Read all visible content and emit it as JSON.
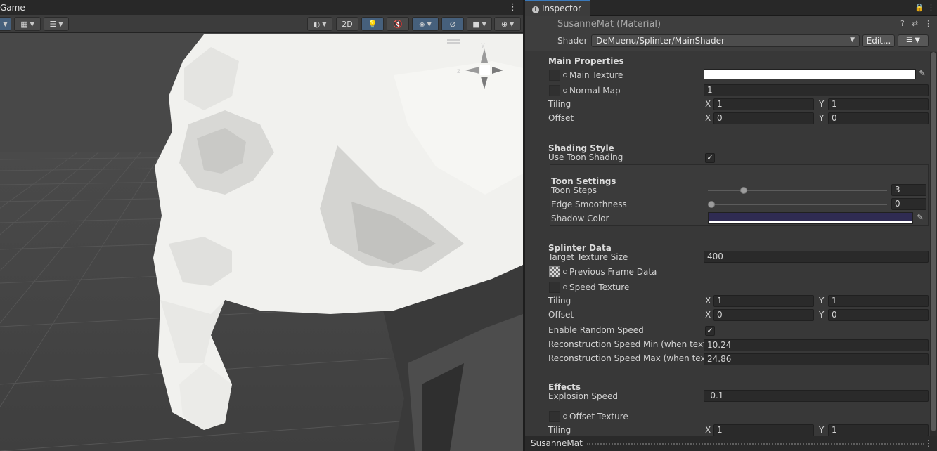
{
  "scene": {
    "tab_label": "Game",
    "kebab": "⋮",
    "toolbar": {
      "mode_2d": "2D"
    }
  },
  "inspector": {
    "tab_label": "Inspector",
    "material_title": "SusanneMat (Material)",
    "shader_label": "Shader",
    "shader_value": "DeMuenu/Splinter/MainShader",
    "edit_button": "Edit...",
    "footer_name": "SusanneMat",
    "sections": {
      "main": {
        "header": "Main Properties",
        "main_texture": "Main Texture",
        "normal_map": "Normal Map",
        "normal_map_value": "1",
        "tiling": "Tiling",
        "tiling_x": "1",
        "tiling_y": "1",
        "offset": "Offset",
        "offset_x": "0",
        "offset_y": "0"
      },
      "shading": {
        "header": "Shading Style",
        "use_toon": "Use Toon Shading",
        "use_toon_checked": true,
        "toon_header": "Toon Settings",
        "toon_steps": "Toon Steps",
        "toon_steps_value": "3",
        "toon_steps_fraction": 0.2,
        "edge_smoothness": "Edge Smoothness",
        "edge_smoothness_value": "0",
        "edge_smoothness_fraction": 0.0,
        "shadow_color": "Shadow Color",
        "shadow_color_hex": "#2f2b52"
      },
      "splinter": {
        "header": "Splinter Data",
        "target_size": "Target Texture Size",
        "target_size_value": "400",
        "prev_frame": "Previous Frame Data",
        "speed_texture": "Speed Texture",
        "tiling": "Tiling",
        "tiling_x": "1",
        "tiling_y": "1",
        "offset": "Offset",
        "offset_x": "0",
        "offset_y": "0",
        "random_speed": "Enable Random Speed",
        "random_speed_checked": true,
        "recon_min": "Reconstruction Speed Min (when textu",
        "recon_min_value": "10.24",
        "recon_max": "Reconstruction Speed Max (when textu",
        "recon_max_value": "24.86"
      },
      "effects": {
        "header": "Effects",
        "explosion_speed": "Explosion Speed",
        "explosion_speed_value": "-0.1",
        "offset_texture": "Offset Texture",
        "tiling": "Tiling",
        "tiling_x": "1",
        "tiling_y": "1"
      }
    },
    "axis_x": "X",
    "axis_y": "Y"
  },
  "colors": {
    "accent_blue": "#46607c",
    "tab_highlight": "#3a79bb",
    "shadow_color": "#2f2b52"
  }
}
